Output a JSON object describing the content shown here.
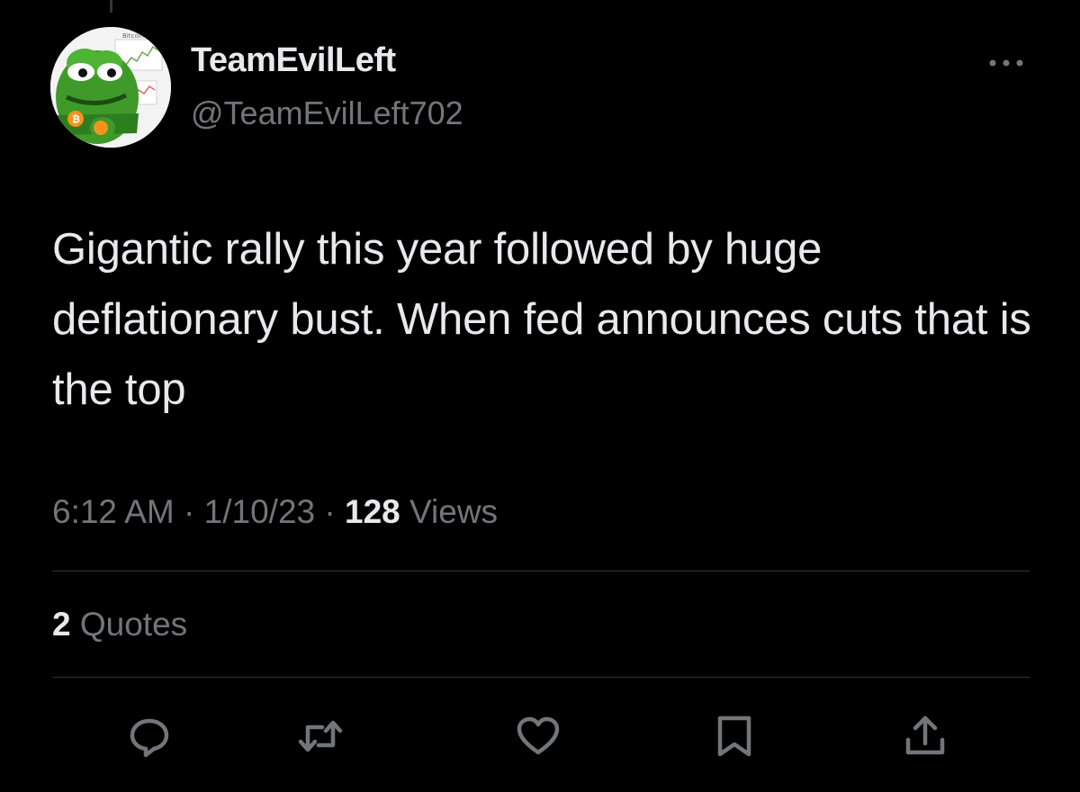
{
  "user": {
    "display_name": "TeamEvilLeft",
    "handle": "@TeamEvilLeft702",
    "avatar_caption": "Bitcoin begins"
  },
  "tweet": {
    "text": "Gigantic rally this year followed by huge deflationary bust. When fed announces cuts that is the top",
    "time": "6:12 AM",
    "date": "1/10/23",
    "views_count": "128",
    "views_label": "Views",
    "separator": "·"
  },
  "engagement": {
    "quotes_count": "2",
    "quotes_label": "Quotes"
  },
  "actions": [
    {
      "name": "reply",
      "icon": "reply-icon"
    },
    {
      "name": "retweet",
      "icon": "retweet-icon"
    },
    {
      "name": "like",
      "icon": "heart-icon"
    },
    {
      "name": "bookmark",
      "icon": "bookmark-icon"
    },
    {
      "name": "share",
      "icon": "share-icon"
    }
  ],
  "more": {
    "icon": "more-horizontal-icon"
  },
  "colors": {
    "background": "#000000",
    "primary_text": "#e7e9ea",
    "secondary_text": "#71767b",
    "divider": "#2f3336",
    "avatar_green": "#3f9a2a"
  }
}
